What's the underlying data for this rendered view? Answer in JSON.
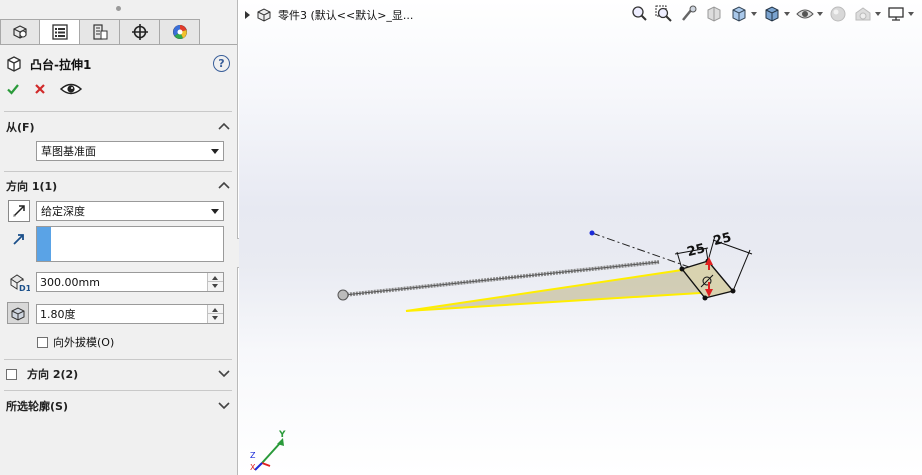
{
  "property_manager": {
    "tabs": [
      {
        "name": "feature-manager-tab",
        "icon": "feature-tree-icon"
      },
      {
        "name": "property-manager-tab",
        "icon": "property-list-icon"
      },
      {
        "name": "configuration-manager-tab",
        "icon": "configuration-icon"
      },
      {
        "name": "dimxpert-tab",
        "icon": "crosshair-icon"
      },
      {
        "name": "display-manager-tab",
        "icon": "appearance-ball-icon"
      }
    ],
    "title": "凸台-拉伸1",
    "from": {
      "header": "从(F)",
      "select_value": "草图基准面"
    },
    "direction1": {
      "header": "方向 1(1)",
      "end_condition": "给定深度",
      "depth": "300.00mm",
      "draft_angle": "1.80度",
      "draft_outward_label": "向外拔模(O)"
    },
    "direction2": {
      "header": "方向 2(2)"
    },
    "contours": {
      "header": "所选轮廓(S)"
    }
  },
  "graphics": {
    "breadcrumb": "零件3 (默认<<默认>_显...",
    "dimensions": [
      "25",
      "25"
    ],
    "triad_labels": [
      "Y",
      "X",
      "Z"
    ],
    "colors": {
      "preview_fill": "#c8c2a0",
      "preview_edge": "#ffee00",
      "dimension_red": "#e02020",
      "axis_blue": "#1a2ad8"
    }
  }
}
